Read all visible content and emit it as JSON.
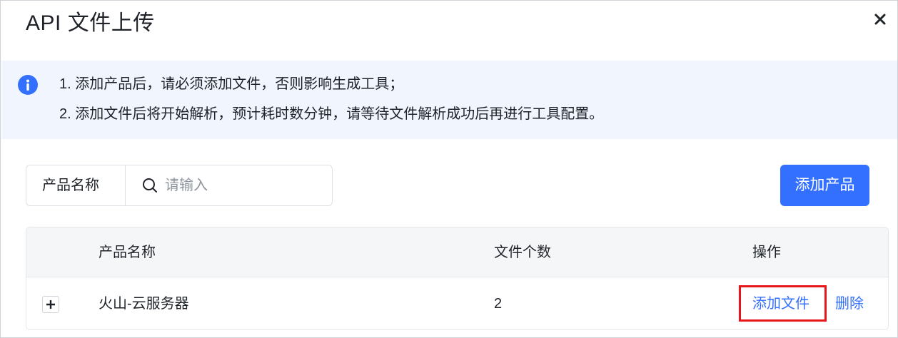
{
  "dialog": {
    "title": "API 文件上传",
    "close_icon": "close-icon"
  },
  "notice": {
    "icon": "info-icon",
    "lines": [
      "1. 添加产品后，请必须添加文件，否则影响生成工具；",
      "2. 添加文件后将开始解析，预计耗时数分钟，请等待文件解析成功后再进行工具配置。"
    ]
  },
  "filter": {
    "label": "产品名称",
    "search_icon": "search-icon",
    "placeholder": "请输入",
    "value": ""
  },
  "toolbar": {
    "add_product_label": "添加产品"
  },
  "table": {
    "columns": [
      "产品名称",
      "文件个数",
      "操作"
    ],
    "rows": [
      {
        "expand_icon": "plus-icon",
        "name": "火山-云服务器",
        "file_count": "2",
        "actions": [
          "添加文件",
          "删除"
        ]
      }
    ]
  },
  "colors": {
    "primary": "#3370ff",
    "notice_bg": "#f1f5fd",
    "highlight_border": "#e8161b"
  }
}
